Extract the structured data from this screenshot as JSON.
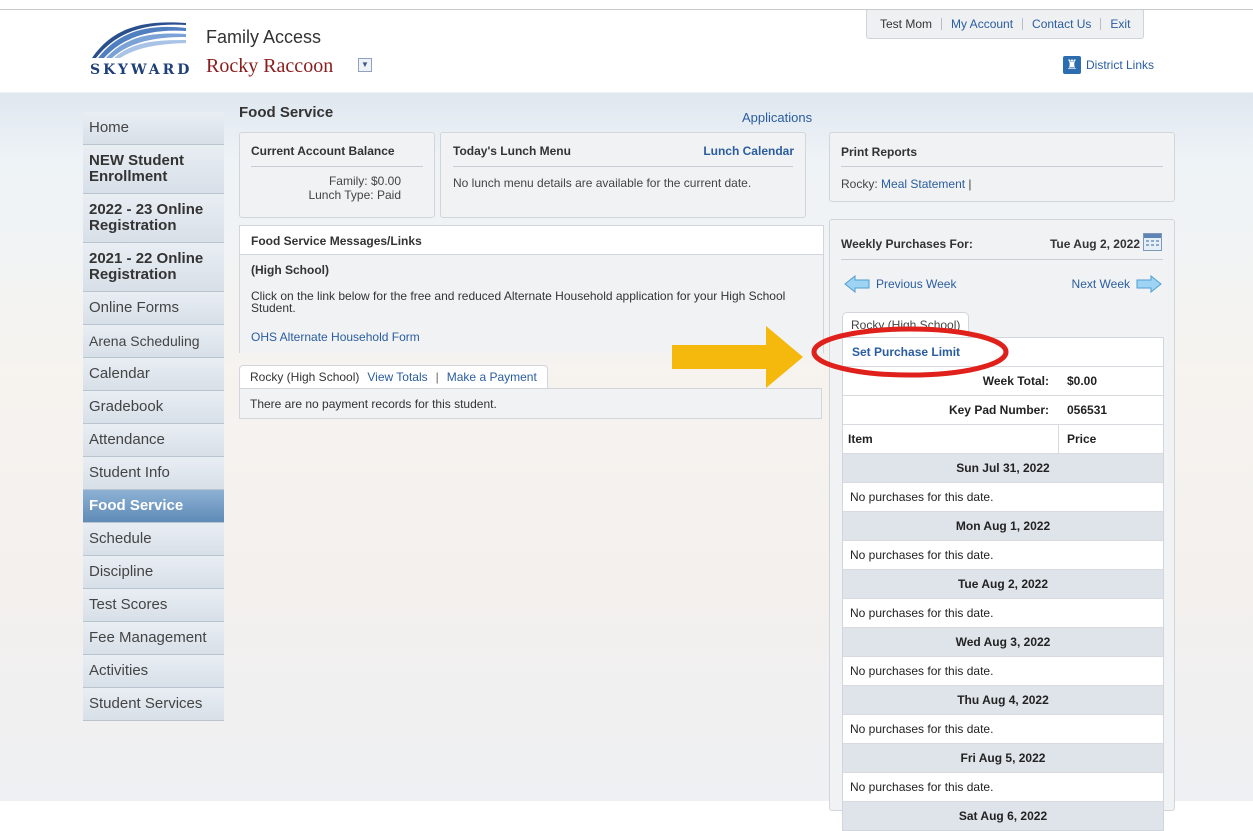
{
  "header": {
    "app_title": "Family Access",
    "logo_text": "SKYWARD",
    "student_name": "Rocky Raccoon",
    "user_name": "Test Mom",
    "my_account": "My Account",
    "contact_us": "Contact Us",
    "exit": "Exit",
    "district_links": "District Links"
  },
  "sidebar": {
    "items": [
      {
        "label": "Home"
      },
      {
        "label": "NEW Student Enrollment"
      },
      {
        "label": "2022 - 23 Online Registration"
      },
      {
        "label": "2021 - 22 Online Registration"
      },
      {
        "label": "Online Forms"
      },
      {
        "label": "Arena Scheduling"
      },
      {
        "label": "Calendar"
      },
      {
        "label": "Gradebook"
      },
      {
        "label": "Attendance"
      },
      {
        "label": "Student Info"
      },
      {
        "label": "Food Service"
      },
      {
        "label": "Schedule"
      },
      {
        "label": "Discipline"
      },
      {
        "label": "Test Scores"
      },
      {
        "label": "Fee Management"
      },
      {
        "label": "Activities"
      },
      {
        "label": "Student Services"
      }
    ]
  },
  "main": {
    "title": "Food Service",
    "applications_link": "Applications",
    "balance": {
      "header": "Current Account Balance",
      "family_label": "Family:",
      "family_value": "$0.00",
      "lunch_type_label": "Lunch Type:",
      "lunch_type_value": "Paid"
    },
    "lunch_menu": {
      "header": "Today's Lunch Menu",
      "calendar_link": "Lunch Calendar",
      "message": "No lunch menu details are available for the current date."
    },
    "messages": {
      "header": "Food Service Messages/Links",
      "school": "(High School)",
      "text": "Click on the link below for the free and reduced Alternate Household application for your High School Student.",
      "link": "OHS Alternate Household Form"
    },
    "payments": {
      "tab_label": "Rocky (High School)",
      "view_totals": "View Totals",
      "make_payment": "Make a Payment",
      "empty_text": "There are no payment records for this student."
    }
  },
  "right": {
    "print_reports": {
      "header": "Print Reports",
      "student_label": "Rocky:",
      "meal_statement": "Meal Statement",
      "separator": "|"
    },
    "weekly": {
      "header": "Weekly Purchases For:",
      "date": "Tue Aug 2, 2022",
      "previous_week": "Previous Week",
      "next_week": "Next Week",
      "student_tab": "Rocky (High School)",
      "set_purchase_limit": "Set Purchase Limit",
      "week_total_label": "Week Total:",
      "week_total_value": "$0.00",
      "keypad_label": "Key Pad Number:",
      "keypad_value": "056531",
      "col_item": "Item",
      "col_price": "Price",
      "days": [
        {
          "date": "Sun Jul 31, 2022",
          "text": "No purchases for this date."
        },
        {
          "date": "Mon Aug 1, 2022",
          "text": "No purchases for this date."
        },
        {
          "date": "Tue Aug 2, 2022",
          "text": "No purchases for this date."
        },
        {
          "date": "Wed Aug 3, 2022",
          "text": "No purchases for this date."
        },
        {
          "date": "Thu Aug 4, 2022",
          "text": "No purchases for this date."
        },
        {
          "date": "Fri Aug 5, 2022",
          "text": "No purchases for this date."
        },
        {
          "date": "Sat Aug 6, 2022",
          "text": ""
        }
      ]
    }
  },
  "annotation": {
    "arrow_color": "#f4b400",
    "circle_color": "#e0201b"
  }
}
